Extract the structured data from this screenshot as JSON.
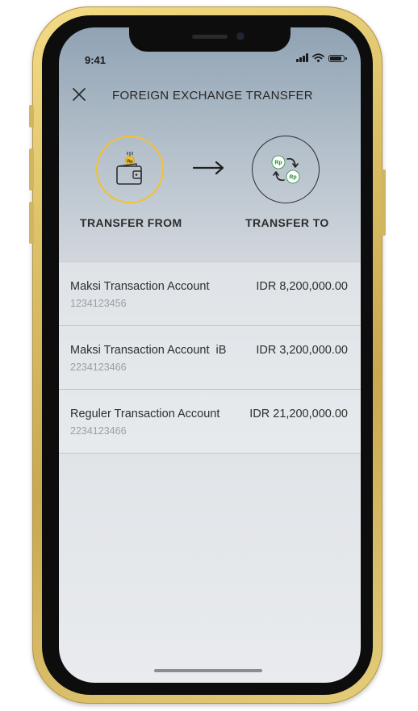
{
  "status_bar": {
    "time": "9:41"
  },
  "header": {
    "title": "FOREIGN EXCHANGE TRANSFER",
    "close_icon": "close-icon"
  },
  "steps": {
    "from": {
      "label": "TRANSFER FROM",
      "icon": "wallet-icon",
      "coin_text": "Rp",
      "accent": "#f2c230"
    },
    "to": {
      "label": "TRANSFER TO",
      "icon": "currency-exchange-icon",
      "coin_text_a": "Rp",
      "coin_text_b": "Rp",
      "coin_color": "#2e8b3e"
    },
    "arrow_icon": "arrow-right-icon"
  },
  "accounts": [
    {
      "name": "Maksi Transaction Account",
      "number": "1234123456",
      "balance": "IDR 8,200,000.00"
    },
    {
      "name": "Maksi Transaction Account  iB",
      "number": "2234123466",
      "balance": "IDR 3,200,000.00"
    },
    {
      "name": "Reguler Transaction Account",
      "number": "2234123466",
      "balance": "IDR 21,200,000.00"
    }
  ]
}
